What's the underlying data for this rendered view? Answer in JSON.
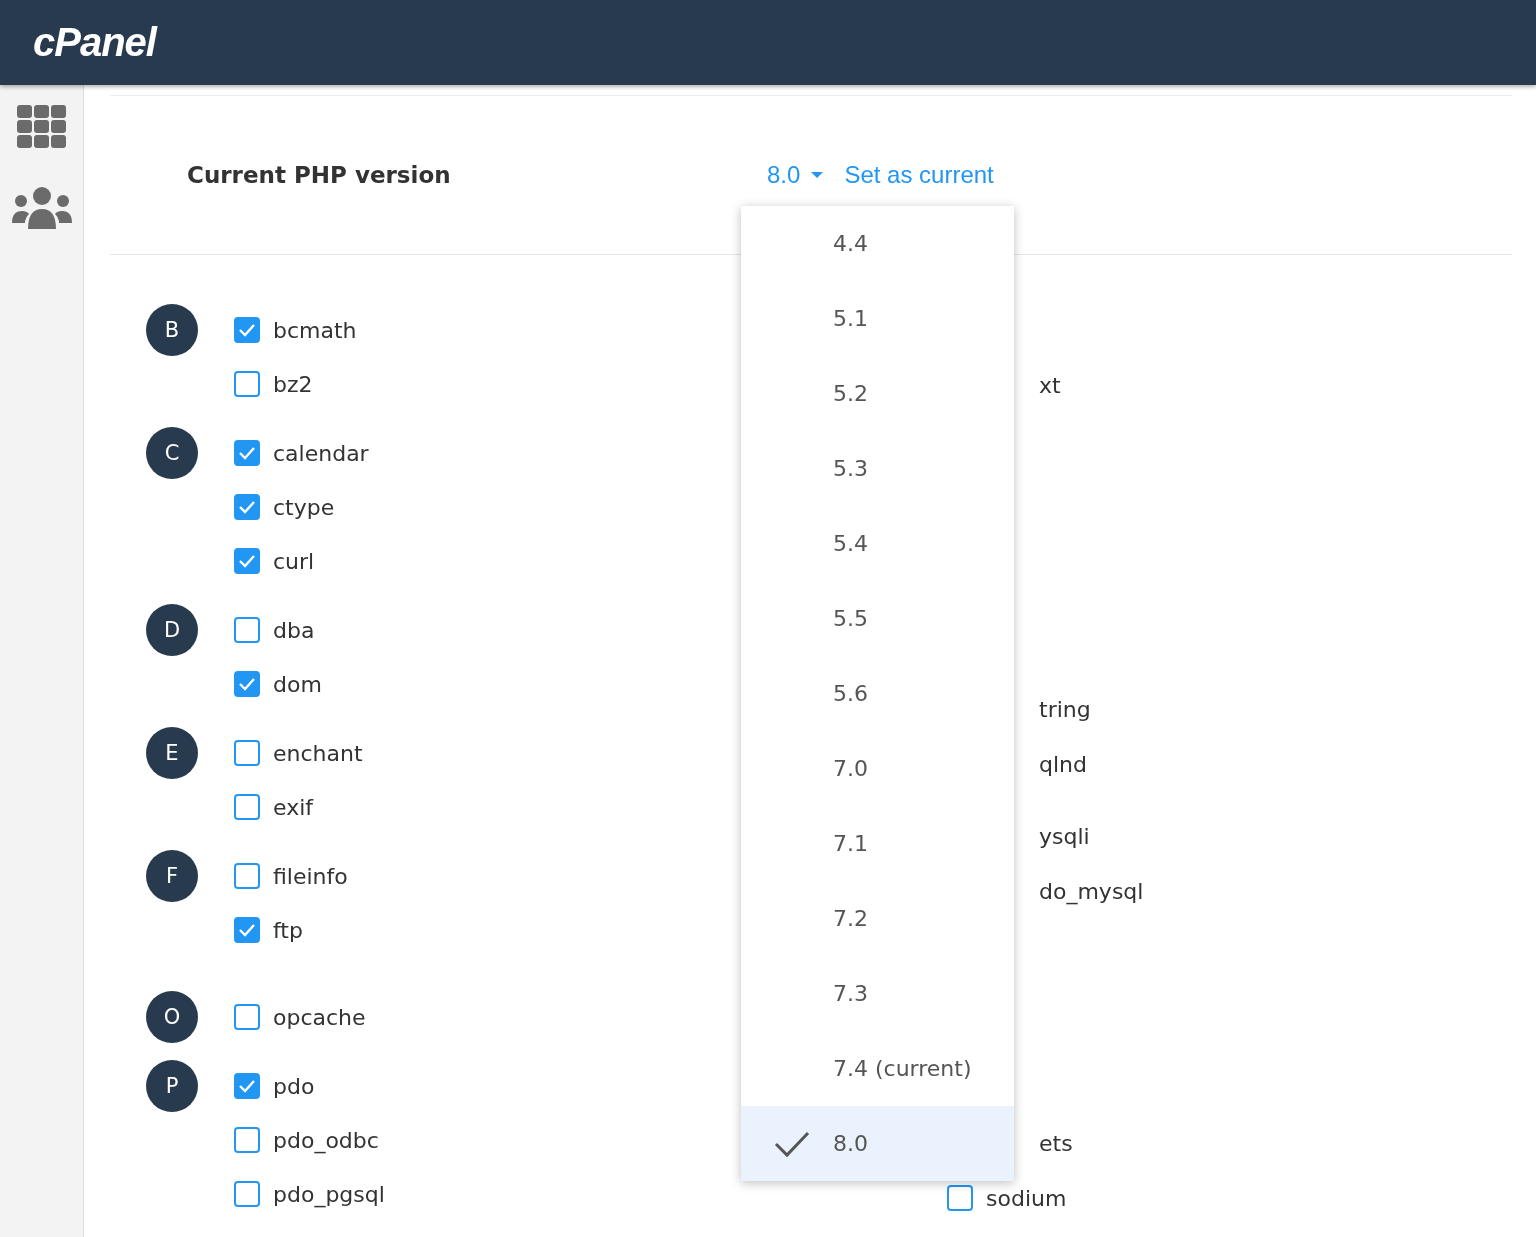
{
  "header": {
    "logo": "cPanel"
  },
  "sidebar": {
    "items": [
      {
        "kind": "grid"
      },
      {
        "kind": "users"
      }
    ]
  },
  "php_version": {
    "label": "Current PHP version",
    "value": "8.0",
    "action": "Set as current"
  },
  "version_menu": {
    "items": [
      {
        "label": "4.4",
        "selected": false
      },
      {
        "label": "5.1",
        "selected": false
      },
      {
        "label": "5.2",
        "selected": false
      },
      {
        "label": "5.3",
        "selected": false
      },
      {
        "label": "5.4",
        "selected": false
      },
      {
        "label": "5.5",
        "selected": false
      },
      {
        "label": "5.6",
        "selected": false
      },
      {
        "label": "7.0",
        "selected": false
      },
      {
        "label": "7.1",
        "selected": false
      },
      {
        "label": "7.2",
        "selected": false
      },
      {
        "label": "7.3",
        "selected": false
      },
      {
        "label": "7.4 (current)",
        "selected": false
      },
      {
        "label": "8.0",
        "selected": true
      }
    ]
  },
  "extension_groups": [
    {
      "letter": "B",
      "extensions": [
        {
          "name": "bcmath",
          "checked": true
        },
        {
          "name": "bz2",
          "checked": false
        }
      ]
    },
    {
      "letter": "C",
      "extensions": [
        {
          "name": "calendar",
          "checked": true
        },
        {
          "name": "ctype",
          "checked": true
        },
        {
          "name": "curl",
          "checked": true
        }
      ]
    },
    {
      "letter": "D",
      "extensions": [
        {
          "name": "dba",
          "checked": false
        },
        {
          "name": "dom",
          "checked": true
        }
      ]
    },
    {
      "letter": "E",
      "extensions": [
        {
          "name": "enchant",
          "checked": false
        },
        {
          "name": "exif",
          "checked": false
        }
      ]
    },
    {
      "letter": "F",
      "extensions": [
        {
          "name": "fileinfo",
          "checked": false
        },
        {
          "name": "ftp",
          "checked": true
        }
      ]
    },
    {
      "letter": "O",
      "extensions": [
        {
          "name": "opcache",
          "checked": false
        }
      ]
    },
    {
      "letter": "P",
      "extensions": [
        {
          "name": "pdo",
          "checked": true
        },
        {
          "name": "pdo_odbc",
          "checked": false
        },
        {
          "name": "pdo_pgsql",
          "checked": false
        }
      ]
    }
  ],
  "right_column": {
    "fragments": [
      "xt",
      "tring",
      "qlnd",
      "ysqli",
      "do_mysql",
      "ets"
    ],
    "extension": {
      "name": "sodium",
      "checked": false
    }
  }
}
